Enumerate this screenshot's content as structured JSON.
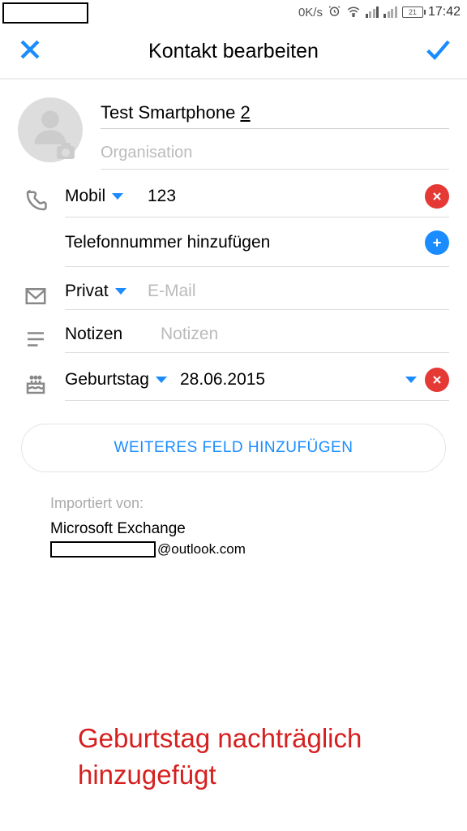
{
  "status": {
    "net": "0K/s",
    "batt": "21",
    "time": "17:42"
  },
  "header": {
    "title": "Kontakt bearbeiten"
  },
  "name": {
    "value_a": "Test Smartphone ",
    "value_b": "2"
  },
  "org": {
    "placeholder": "Organisation"
  },
  "phone": {
    "type": "Mobil",
    "value": "123"
  },
  "addphone": "Telefonnummer hinzufügen",
  "email": {
    "type": "Privat",
    "placeholder": "E-Mail"
  },
  "notes": {
    "type": "Notizen",
    "placeholder": "Notizen"
  },
  "bday": {
    "type": "Geburtstag",
    "value": "28.06.2015"
  },
  "addfield": "WEITERES FELD HINZUFÜGEN",
  "imported": {
    "label": "Importiert von:",
    "source": "Microsoft Exchange",
    "suffix": "@outlook.com"
  },
  "annotation": "Geburtstag nachträglich hinzugefügt"
}
